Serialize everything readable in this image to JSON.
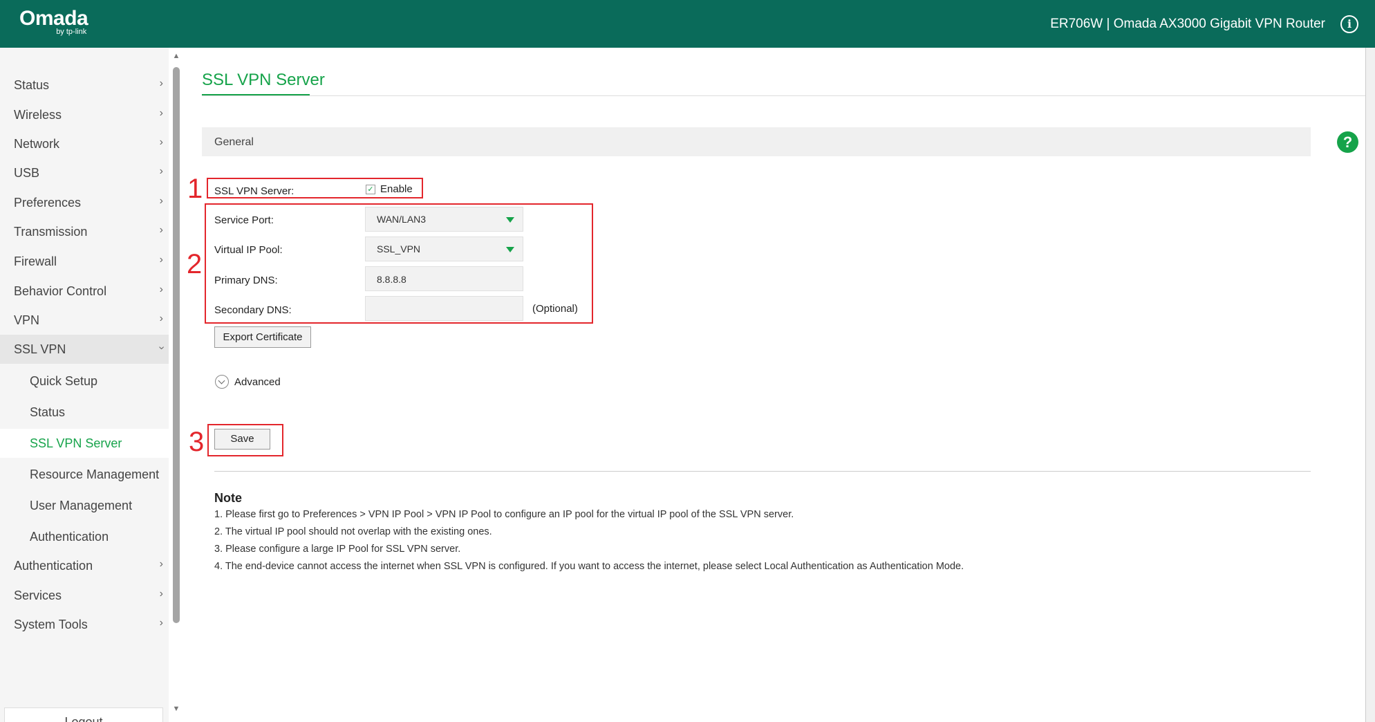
{
  "header": {
    "logo": "Omada",
    "logo_sub": "by tp-link",
    "device_info": "ER706W  |  Omada AX3000 Gigabit VPN Router",
    "info_icon": "i"
  },
  "sidebar": {
    "items": [
      {
        "label": "Status"
      },
      {
        "label": "Wireless"
      },
      {
        "label": "Network"
      },
      {
        "label": "USB"
      },
      {
        "label": "Preferences"
      },
      {
        "label": "Transmission"
      },
      {
        "label": "Firewall"
      },
      {
        "label": "Behavior Control"
      },
      {
        "label": "VPN"
      },
      {
        "label": "SSL VPN"
      },
      {
        "label": "Authentication"
      },
      {
        "label": "Services"
      },
      {
        "label": "System Tools"
      }
    ],
    "sub_items": [
      {
        "label": "Quick Setup"
      },
      {
        "label": "Status"
      },
      {
        "label": "SSL VPN Server"
      },
      {
        "label": "Resource Management"
      },
      {
        "label": "User Management"
      },
      {
        "label": "Authentication"
      }
    ],
    "logout": "Logout"
  },
  "main": {
    "title": "SSL VPN Server",
    "section": "General",
    "help_icon": "?",
    "form": {
      "ssl_vpn_server_label": "SSL VPN Server:",
      "enable_label": "Enable",
      "enable_checked": true,
      "service_port_label": "Service Port:",
      "service_port_value": "WAN/LAN3",
      "virtual_ip_pool_label": "Virtual IP Pool:",
      "virtual_ip_pool_value": "SSL_VPN",
      "primary_dns_label": "Primary DNS:",
      "primary_dns_value": "8.8.8.8",
      "secondary_dns_label": "Secondary DNS:",
      "secondary_dns_value": "",
      "optional": "(Optional)"
    },
    "export_button": "Export Certificate",
    "advanced": "Advanced",
    "save_button": "Save",
    "note": {
      "title": "Note",
      "lines": [
        "1. Please first go to Preferences > VPN IP Pool > VPN IP Pool to configure an IP pool for the virtual IP pool of the SSL VPN server.",
        "2. The virtual IP pool should not overlap with the existing ones.",
        "3. Please configure a large IP Pool for SSL VPN server.",
        "4. The end-device cannot access the internet when SSL VPN is configured. If you want to access the internet, please select Local Authentication as Authentication Mode."
      ]
    }
  },
  "annotations": [
    "1",
    "2",
    "3"
  ],
  "colors": {
    "header_bg": "#0a6b5a",
    "accent_green": "#16a34a",
    "annotation_red": "#e3262c"
  }
}
